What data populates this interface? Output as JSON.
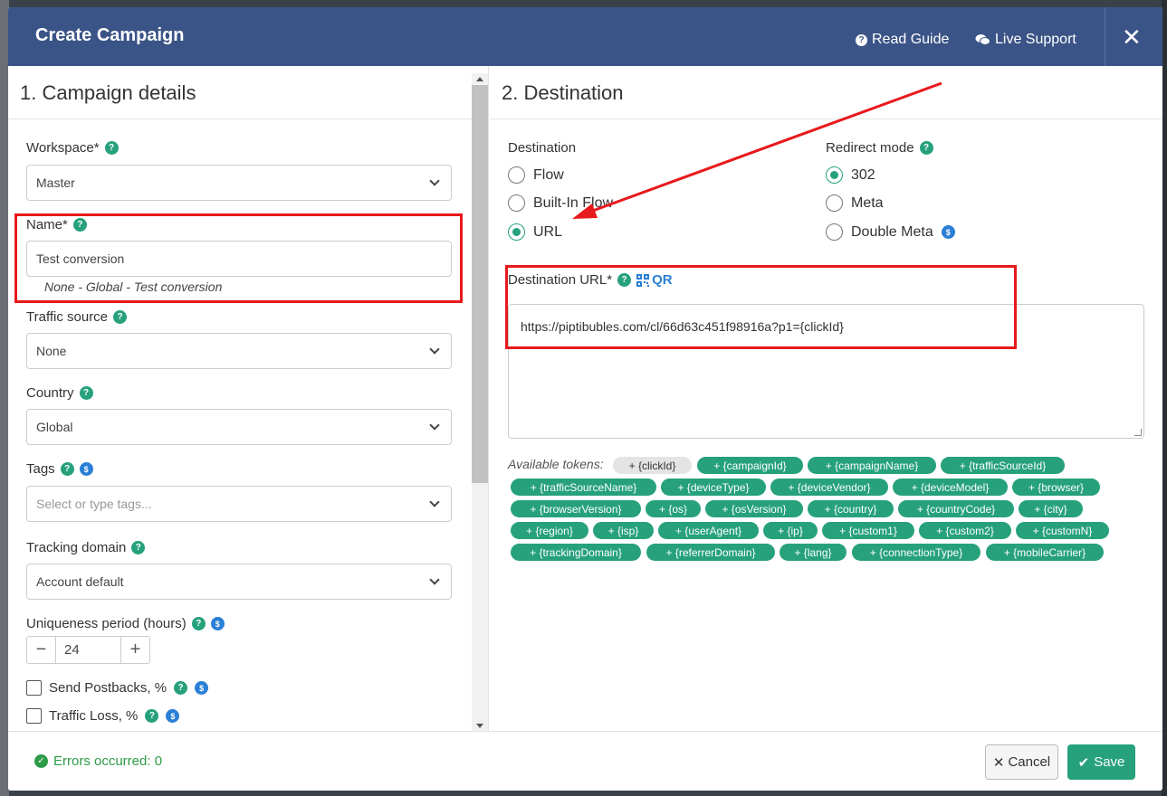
{
  "header": {
    "title": "Create Campaign",
    "read_guide": "Read Guide",
    "live_support": "Live Support",
    "close": "✕"
  },
  "left": {
    "section_title": "1. Campaign details",
    "workspace": {
      "label": "Workspace*",
      "value": "Master"
    },
    "name": {
      "label": "Name*",
      "value": "Test conversion",
      "hint": "None - Global - Test conversion"
    },
    "traffic_source": {
      "label": "Traffic source",
      "value": "None"
    },
    "country": {
      "label": "Country",
      "value": "Global"
    },
    "tags": {
      "label": "Tags",
      "placeholder": "Select or type tags..."
    },
    "tracking_domain": {
      "label": "Tracking domain",
      "value": "Account default"
    },
    "uniqueness": {
      "label": "Uniqueness period (hours)",
      "value": "24",
      "minus": "−",
      "plus": "+"
    },
    "send_postbacks": {
      "label": "Send Postbacks, %"
    },
    "traffic_loss": {
      "label": "Traffic Loss, %"
    }
  },
  "right": {
    "section_title": "2. Destination",
    "destination": {
      "label": "Destination",
      "options": [
        "Flow",
        "Built-In Flow",
        "URL"
      ],
      "selected": "URL"
    },
    "redirect_mode": {
      "label": "Redirect mode",
      "options": [
        "302",
        "Meta",
        "Double Meta"
      ],
      "selected": "302"
    },
    "destination_url": {
      "label": "Destination URL*",
      "qr": "QR",
      "value": "https://piptibubles.com/cl/66d63c451f98916a?p1={clickId}"
    },
    "tokens_label": "Available tokens:",
    "tokens": [
      "+ {clickId}",
      "+ {campaignId}",
      "+ {campaignName}",
      "+ {trafficSourceId}",
      "+ {trafficSourceName}",
      "+ {deviceType}",
      "+ {deviceVendor}",
      "+ {deviceModel}",
      "+ {browser}",
      "+ {browserVersion}",
      "+ {os}",
      "+ {osVersion}",
      "+ {country}",
      "+ {countryCode}",
      "+ {city}",
      "+ {region}",
      "+ {isp}",
      "+ {userAgent}",
      "+ {ip}",
      "+ {custom1}",
      "+ {custom2}",
      "+ {customN}",
      "+ {trackingDomain}",
      "+ {referrerDomain}",
      "+ {lang}",
      "+ {connectionType}",
      "+ {mobileCarrier}"
    ]
  },
  "footer": {
    "status": "Errors occurred: 0",
    "cancel": "Cancel",
    "save": "Save"
  },
  "colors": {
    "header_bg": "#3b5487",
    "accent_green": "#26a17c",
    "highlight_red": "#e8191c",
    "link_blue": "#2a7fd6"
  }
}
